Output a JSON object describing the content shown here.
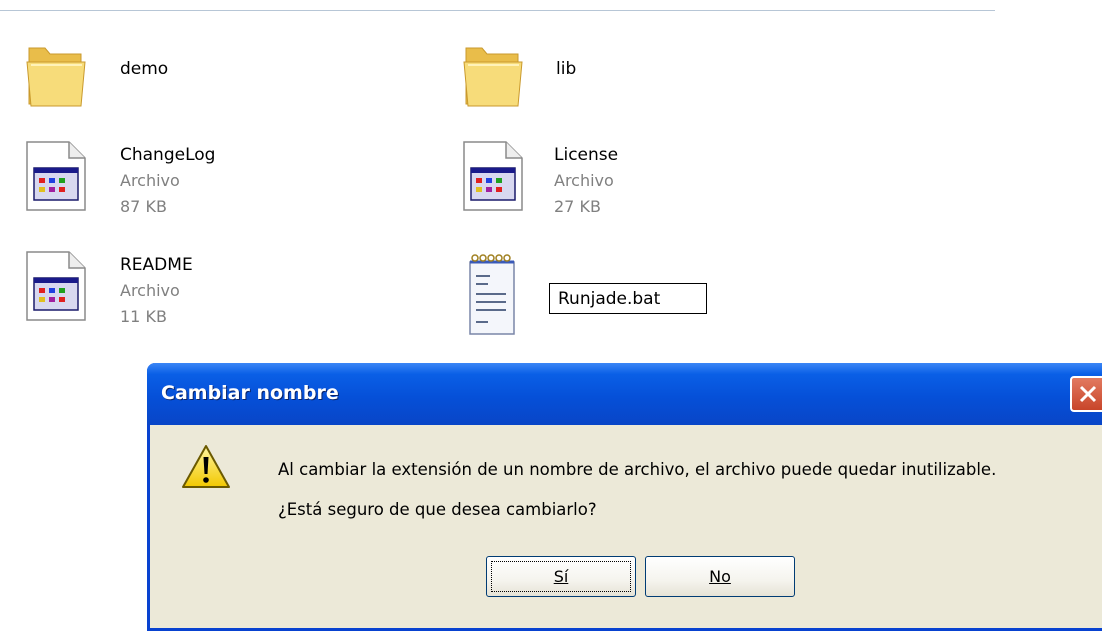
{
  "files": [
    {
      "id": "demo",
      "name": "demo",
      "type": "folder"
    },
    {
      "id": "lib",
      "name": "lib",
      "type": "folder"
    },
    {
      "id": "changelog",
      "name": "ChangeLog",
      "kind": "Archivo",
      "size": "87 KB",
      "type": "file"
    },
    {
      "id": "license",
      "name": "License",
      "kind": "Archivo",
      "size": "27 KB",
      "type": "file"
    },
    {
      "id": "readme",
      "name": "README",
      "kind": "Archivo",
      "size": "11 KB",
      "type": "file"
    },
    {
      "id": "runjade",
      "type": "notepad-file"
    }
  ],
  "rename": {
    "value": "Runjade.bat"
  },
  "dialog": {
    "title": "Cambiar nombre",
    "message": "Al cambiar la extensión de un nombre de archivo, el archivo puede quedar inutilizable.",
    "question": "¿Está seguro de que desea cambiarlo?",
    "yes_label": "Sí",
    "no_label": "No",
    "icon": "warning-icon"
  },
  "colors": {
    "titlebar": "#0650d8",
    "dialog_bg": "#ece9d8",
    "folder": "#f5d66b",
    "secondary_text": "#808080"
  }
}
